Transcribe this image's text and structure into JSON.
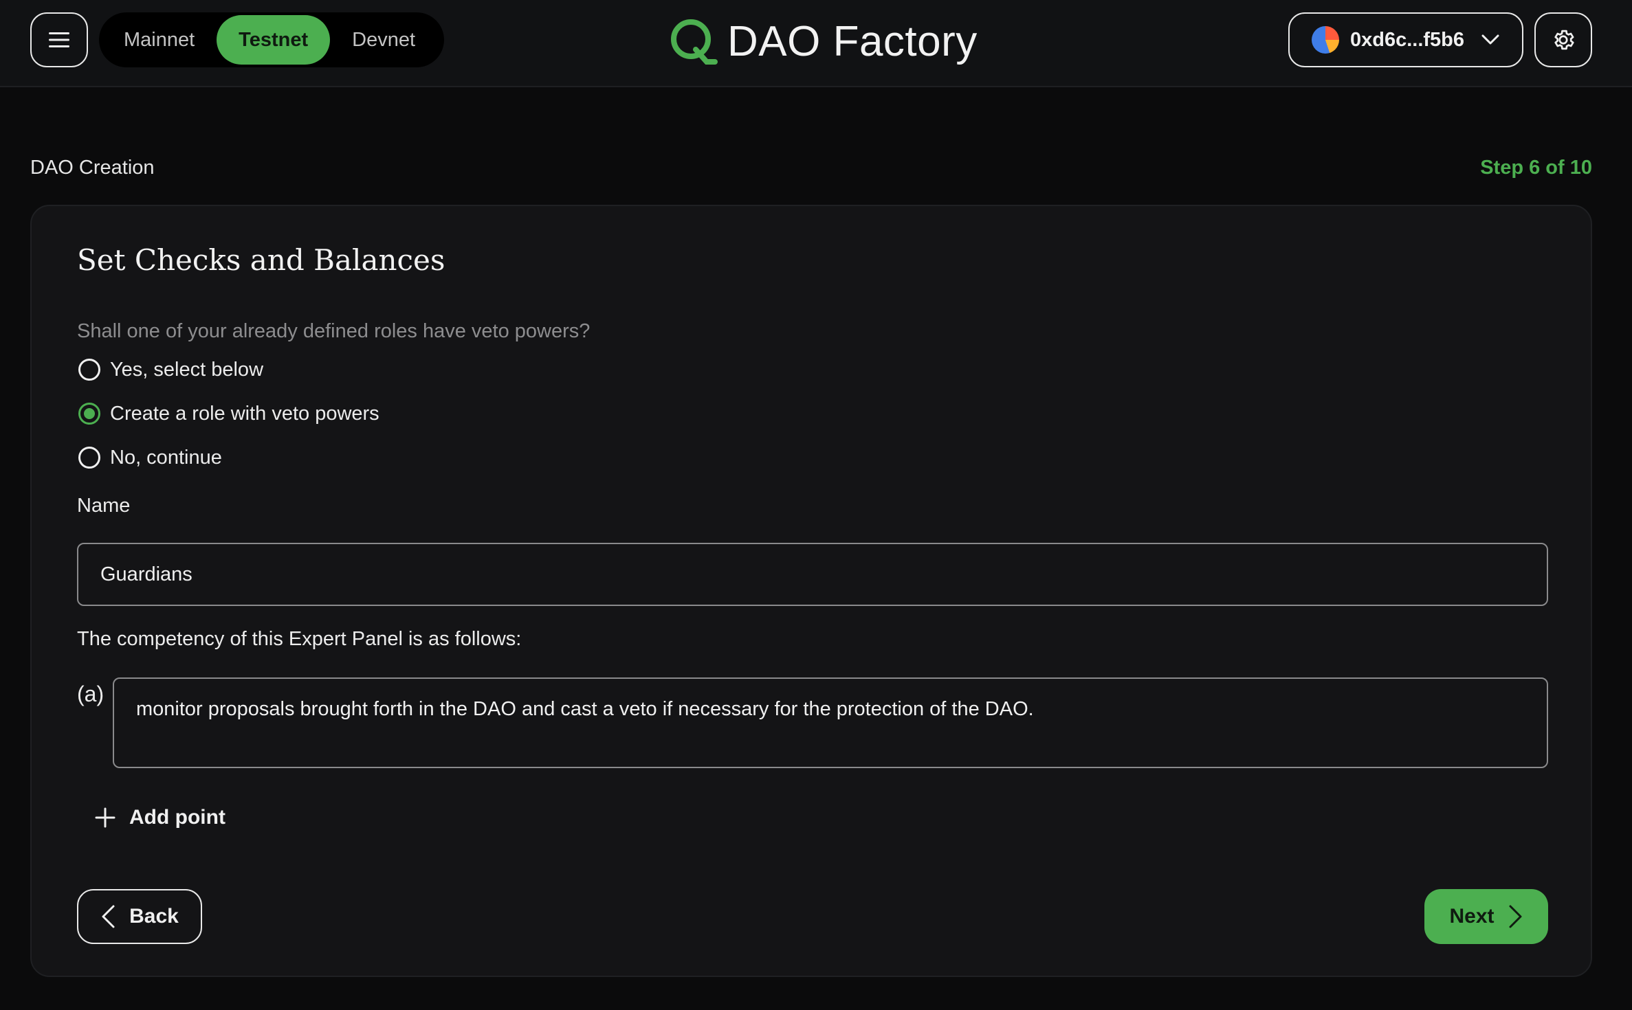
{
  "header": {
    "networks": [
      {
        "label": "Mainnet",
        "active": false
      },
      {
        "label": "Testnet",
        "active": true
      },
      {
        "label": "Devnet",
        "active": false
      }
    ],
    "app_title": "DAO Factory",
    "wallet_address": "0xd6c...f5b6"
  },
  "page": {
    "breadcrumb": "DAO Creation",
    "step": "Step 6 of 10"
  },
  "form": {
    "title": "Set Checks and Balances",
    "question": "Shall one of your already defined roles have veto powers?",
    "options": [
      {
        "label": "Yes, select below",
        "checked": false
      },
      {
        "label": "Create a role with veto powers",
        "checked": true
      },
      {
        "label": "No, continue",
        "checked": false
      }
    ],
    "name_label": "Name",
    "name_value": "Guardians",
    "competency_label": "The competency of this Expert Panel is as follows:",
    "points": [
      {
        "marker": "(a)",
        "text": "monitor proposals brought forth in the DAO and cast a veto if necessary for the protection of the DAO."
      }
    ],
    "add_point_label": "Add point",
    "back_label": "Back",
    "next_label": "Next"
  },
  "colors": {
    "accent": "#4caf50",
    "background": "#0b0b0c",
    "card": "#141416"
  }
}
